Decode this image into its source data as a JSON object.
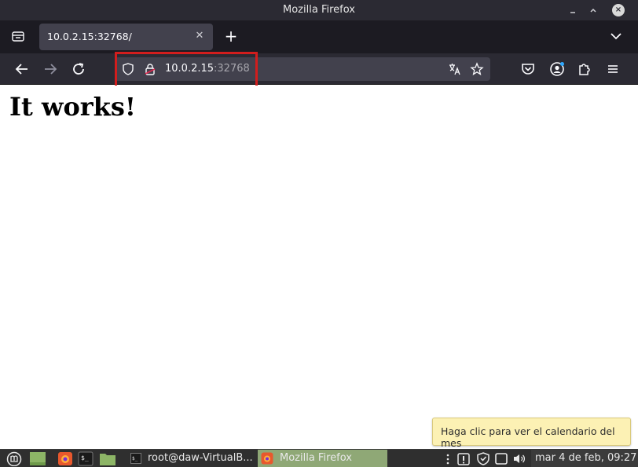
{
  "window": {
    "title": "Mozilla Firefox"
  },
  "tabs": [
    {
      "title": "10.0.2.15:32768/"
    }
  ],
  "urlbar": {
    "host": "10.0.2.15",
    "port": ":32768"
  },
  "page": {
    "heading": "It works!"
  },
  "tooltip": {
    "text": "Haga clic para ver el calendario del mes"
  },
  "taskbar": {
    "tasks": [
      {
        "label": "root@daw-VirtualB..."
      },
      {
        "label": "Mozilla Firefox"
      }
    ],
    "clock": "mar  4 de feb, 09:27"
  },
  "colors": {
    "accent": "#d21d1d",
    "toolbar": "#2b2a33",
    "tabstrip": "#1c1b22",
    "active_task": "#8fa876"
  }
}
